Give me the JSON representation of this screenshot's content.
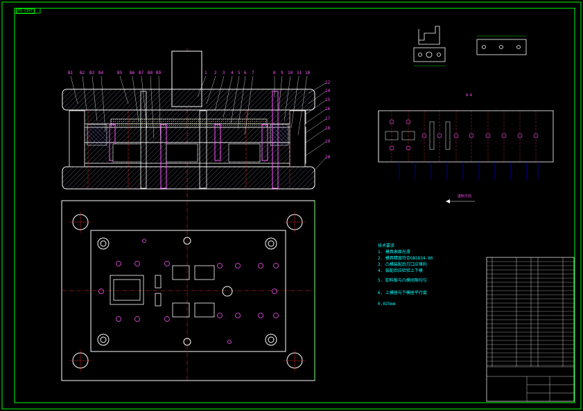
{
  "drawing": {
    "code": "PS-C397",
    "upper_labels_left": [
      "B1",
      "B2",
      "B3",
      "B4",
      "B5",
      "B6",
      "B7",
      "B8",
      "B9"
    ],
    "upper_labels_mid": [
      "1",
      "2",
      "3",
      "4",
      "5",
      "6",
      "7"
    ],
    "upper_labels_right": [
      "8",
      "9",
      "10",
      "11",
      "18"
    ],
    "side_labels": [
      "12",
      "14",
      "15",
      "16",
      "17",
      "18",
      "19",
      "20"
    ],
    "section_mark": "A-A",
    "direction_label": "送料方向",
    "notes": [
      "技术要求",
      "1. 模具表面光滑",
      "2. 模具精度符合GB1834-80",
      "3. 凸模装配后刃口应锋利",
      "4. 装配后应检验上下模",
      "5. 卸料板与凸模间隙均匀",
      "6. 上模座与下模座平行度",
      "0.025mm"
    ]
  },
  "colors": {
    "frame": "#00ff00",
    "outline": "#ffffff",
    "label": "#ff55ff",
    "note": "#00ffff",
    "center": "#ff3030",
    "hatch": "#8888ff"
  }
}
